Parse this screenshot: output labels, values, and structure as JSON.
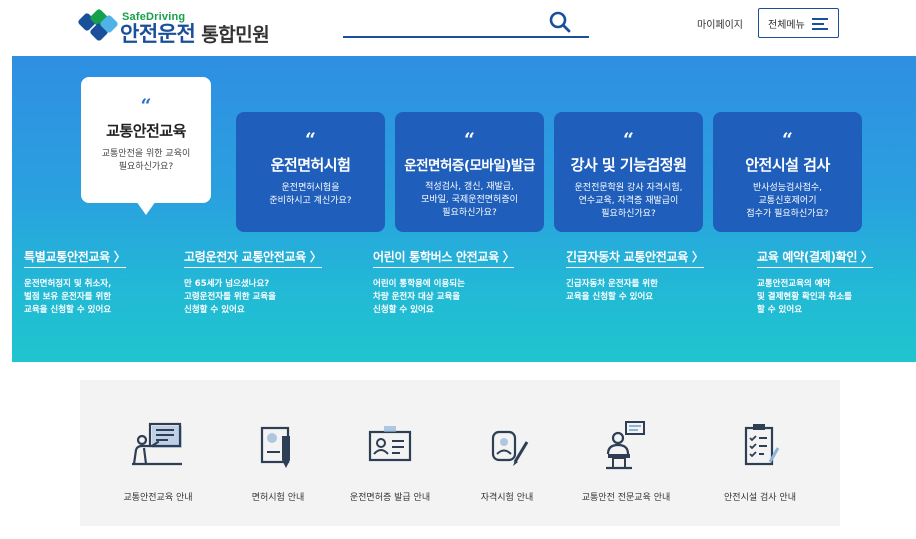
{
  "header": {
    "logo_sub": "SafeDriving",
    "logo_brand": "안전운전",
    "logo_tail": "통합민원",
    "search_placeholder": "",
    "mypage_label": "마이페이지",
    "allmenu_label": "전체메뉴"
  },
  "cards": [
    {
      "quote": "“",
      "title": "교통안전교육",
      "desc": "교통안전을 위한 교육이\n필요하신가요?",
      "active": true
    },
    {
      "quote": "“",
      "title": "운전면허시험",
      "desc": "운전면허시험을\n준비하시고 계신가요?"
    },
    {
      "quote": "“",
      "title": "운전면허증(모바일)발급",
      "desc": "적성검사, 갱신, 재발급,\n모바일, 국제운전면허증이\n필요하신가요?"
    },
    {
      "quote": "“",
      "title": "강사 및 기능검정원",
      "desc": "운전전문학원 강사 자격시험,\n연수교육, 자격증 재발급이\n필요하신가요?"
    },
    {
      "quote": "“",
      "title": "안전시설 검사",
      "desc": "반사성능검사접수,\n교통신호제어기\n접수가 필요하신가요?"
    }
  ],
  "links": [
    {
      "title": "특별교통안전교육 〉",
      "desc": "운전면허정지 및 취소자,\n벌점 보유 운전자를 위한\n교육을 신청할 수 있어요"
    },
    {
      "title": "고령운전자 교통안전교육 〉",
      "desc": "만 65세가 넘으셨나요?\n고령운전자를 위한 교육을\n신청할 수 있어요"
    },
    {
      "title": "어린이 통학버스 안전교육 〉",
      "desc": "어린이 통학용에 이용되는\n차량 운전자 대상 교육을\n신청할 수 있어요"
    },
    {
      "title": "긴급자동차 교통안전교육 〉",
      "desc": "긴급자동차 운전자를 위한\n교육을 신청할 수 있어요"
    },
    {
      "title": "교육 예약(결제)확인 〉",
      "desc": "교통안전교육의 예약\n및 결제현황 확인과 취소를\n할 수 있어요"
    }
  ],
  "services": [
    {
      "label": "교통안전교육 안내",
      "icon": "lecture-board-icon"
    },
    {
      "label": "면허시험 안내",
      "icon": "exam-paper-pen-icon"
    },
    {
      "label": "운전면허증 발급 안내",
      "icon": "license-card-icon"
    },
    {
      "label": "자격시험 안내",
      "icon": "qualification-pen-icon"
    },
    {
      "label": "교통안전 전문교육 안내",
      "icon": "speaker-podium-icon"
    },
    {
      "label": "안전시설 검사 안내",
      "icon": "checklist-clipboard-icon"
    }
  ],
  "colors": {
    "brand_blue": "#1a4f9c",
    "brand_green": "#16a04b",
    "card_blue": "#1f5fbb",
    "icon_navy": "#2d3e55",
    "icon_accent": "#8fb3d9"
  }
}
